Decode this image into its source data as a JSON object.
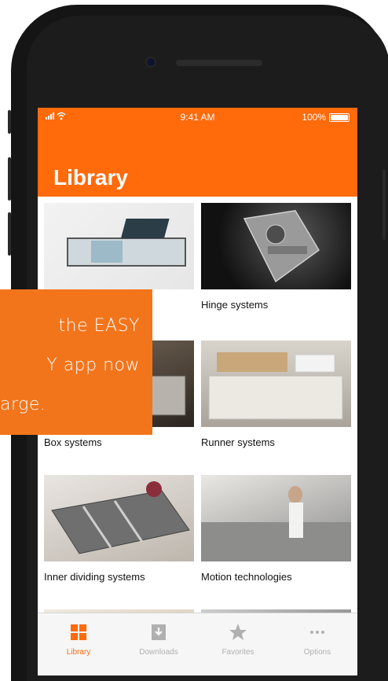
{
  "status_bar": {
    "time": "9:41 AM",
    "battery": "100%"
  },
  "header": {
    "title": "Library"
  },
  "grid": [
    {
      "label": "",
      "image": "cabinet-image"
    },
    {
      "label": "Hinge systems",
      "image": "hinge-image"
    },
    {
      "label": "Box systems",
      "image": "box-image"
    },
    {
      "label": "Runner systems",
      "image": "runner-image"
    },
    {
      "label": "Inner dividing systems",
      "image": "inner-dividing-image"
    },
    {
      "label": "Motion technologies",
      "image": "motion-image"
    }
  ],
  "tabbar": {
    "items": [
      {
        "label": "Library",
        "icon": "library-grid-icon",
        "active": true
      },
      {
        "label": "Downloads",
        "icon": "download-icon",
        "active": false
      },
      {
        "label": "Favorites",
        "icon": "star-icon",
        "active": false
      },
      {
        "label": "Options",
        "icon": "more-icon",
        "active": false
      }
    ]
  },
  "promo": {
    "line1": "the EASY",
    "line2": "Y app now",
    "line3": "arge."
  },
  "colors": {
    "accent": "#ff6a0b",
    "promo": "#f2751c"
  }
}
